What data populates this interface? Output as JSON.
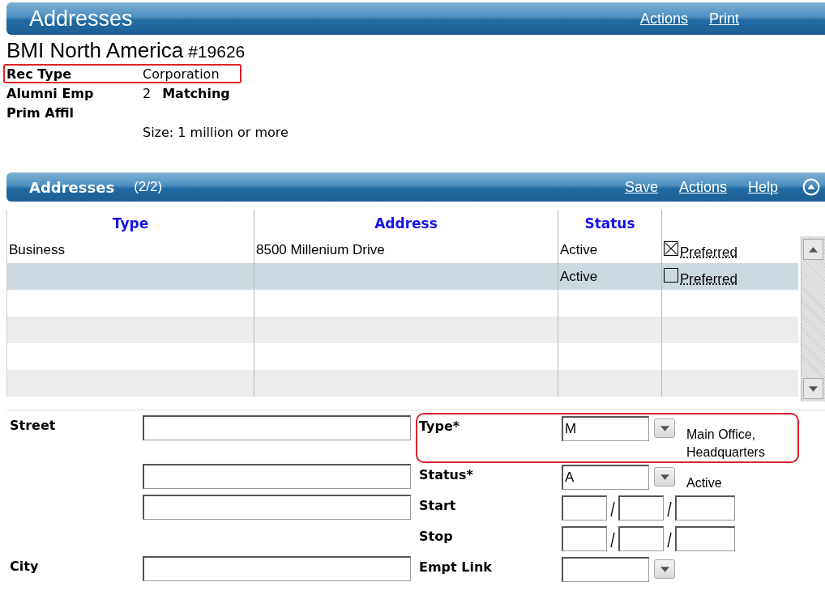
{
  "header": {
    "title": "Addresses",
    "links": [
      "Actions",
      "Print"
    ]
  },
  "record": {
    "name": "BMI North America",
    "number": "#19626",
    "fields": [
      {
        "label": "Rec Type",
        "value": "Corporation",
        "highlighted": true
      },
      {
        "label": "Alumni Emp",
        "value": "2",
        "extra": "Matching",
        "highlighted": false
      },
      {
        "label": "Prim Affil",
        "highlighted": false
      }
    ],
    "note": "Size: 1 million or more"
  },
  "section": {
    "title": "Addresses",
    "count": "(2/2)",
    "links": [
      "Save",
      "Actions",
      "Help"
    ]
  },
  "table": {
    "columns": [
      "Type",
      "Address",
      "Status"
    ],
    "rows": [
      {
        "type": "Business",
        "address": "8500 Millenium Drive",
        "status": "Active",
        "preferred": {
          "checked": true,
          "label": "Preferred"
        },
        "selected": false
      },
      {
        "type": "",
        "address": "",
        "status": "Active",
        "preferred": {
          "checked": false,
          "label": "Preferred"
        },
        "selected": true
      }
    ]
  },
  "form": {
    "rows": [
      {
        "left_label": "Street",
        "left_field": true,
        "right": {
          "kind": "select",
          "label": "Type*",
          "value": "M",
          "description": "Main Office, Headquarters",
          "highlighted": true
        }
      },
      {
        "left_field": true,
        "right": {
          "kind": "select",
          "label": "Status*",
          "value": "A",
          "description": "Active",
          "highlighted": false
        }
      },
      {
        "left_field": true,
        "right": {
          "kind": "date",
          "label": "Start",
          "highlighted": false
        }
      },
      {
        "left_field": false,
        "right": {
          "kind": "date",
          "label": "Stop",
          "highlighted": false
        }
      },
      {
        "left_label": "City",
        "left_field": true,
        "right": {
          "kind": "select",
          "label": "Empt Link",
          "highlighted": false
        }
      }
    ]
  }
}
